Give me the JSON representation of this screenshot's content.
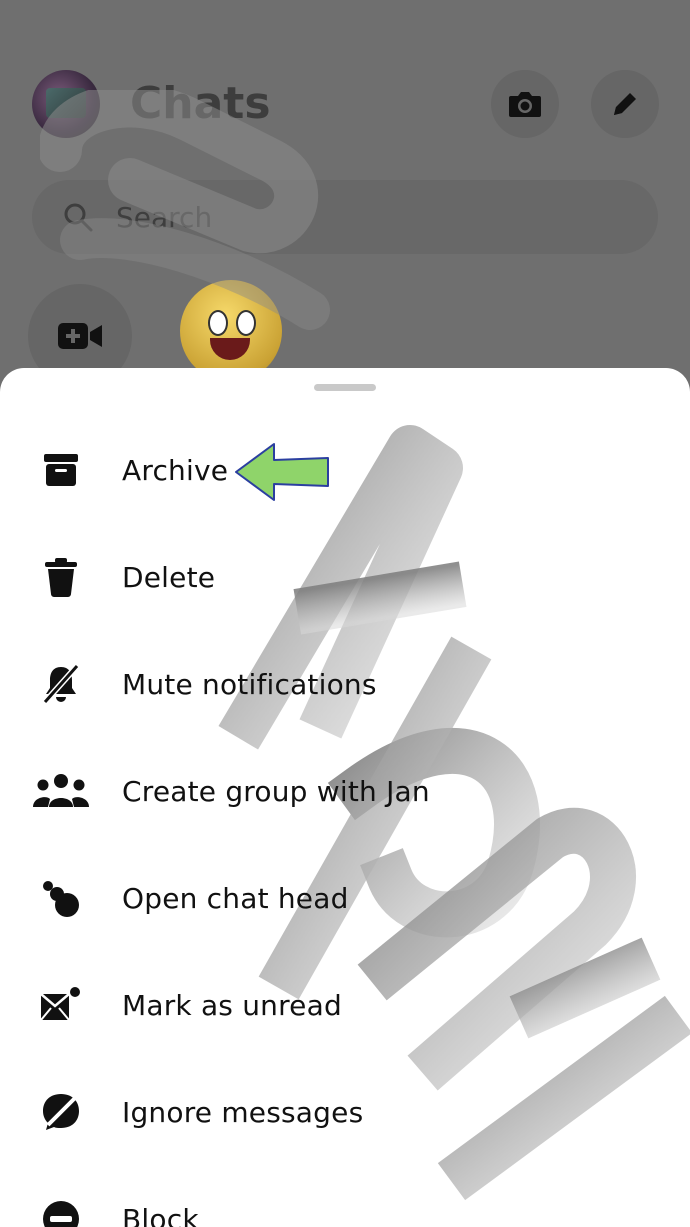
{
  "header": {
    "title": "Chats"
  },
  "search": {
    "placeholder": "Search"
  },
  "menu": {
    "items": [
      {
        "label": "Archive",
        "icon": "archive-icon"
      },
      {
        "label": "Delete",
        "icon": "trash-icon"
      },
      {
        "label": "Mute notifications",
        "icon": "bell-off-icon"
      },
      {
        "label": "Create group with Jan",
        "icon": "group-icon"
      },
      {
        "label": "Open chat head",
        "icon": "chat-head-icon"
      },
      {
        "label": "Mark as unread",
        "icon": "mail-unread-icon"
      },
      {
        "label": "Ignore messages",
        "icon": "ignore-icon"
      },
      {
        "label": "Block",
        "icon": "block-icon"
      }
    ]
  },
  "colors": {
    "overlay": "#6f6f6f",
    "sheet": "#ffffff",
    "arrow_fill": "#8fd46a",
    "arrow_stroke": "#2b3fa0"
  }
}
